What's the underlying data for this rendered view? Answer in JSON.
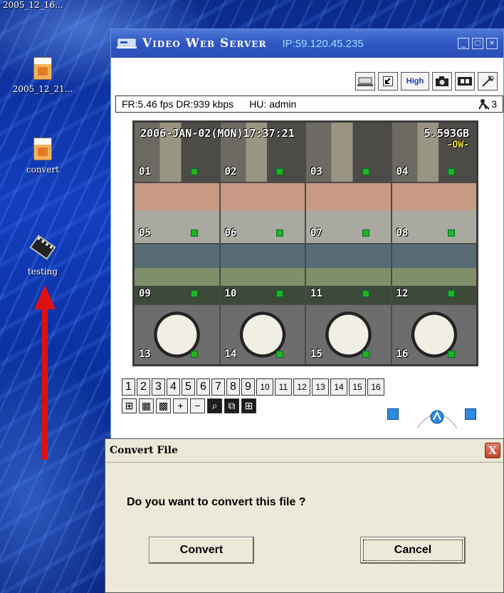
{
  "desktop": {
    "top_label": "2005_12_16...",
    "icons": [
      {
        "label": "2005_12_21...",
        "icon": "file-icon"
      },
      {
        "label": "convert",
        "icon": "file-icon"
      },
      {
        "label": "testing",
        "icon": "video-file-icon"
      }
    ],
    "arrow_color": "#e01010"
  },
  "video_server": {
    "title": "Video Web Server",
    "ip": "IP:59.120.45.235",
    "window_controls": [
      "_",
      "□",
      "×"
    ],
    "toolbar": {
      "high_label": "High"
    },
    "status": {
      "frame_rate": "FR:5.46 fps DR:939 kbps",
      "user": "HU: admin",
      "user_count": "3"
    },
    "osd": {
      "datetime": "2006-JAN-02(MON)17:37:21",
      "disk": "5.593GB",
      "overwrite": "-OW-"
    },
    "cameras": [
      "01",
      "02",
      "03",
      "04",
      "05",
      "06",
      "07",
      "08",
      "09",
      "10",
      "11",
      "12",
      "13",
      "14",
      "15",
      "16"
    ],
    "channel_buttons": [
      "1",
      "2",
      "3",
      "4",
      "5",
      "6",
      "7",
      "8",
      "9",
      "10",
      "11",
      "12",
      "13",
      "14",
      "15",
      "16"
    ],
    "view_buttons": [
      "⊞",
      "▦",
      "▩",
      "+",
      "−",
      "⌕",
      "⧉",
      "⊞"
    ],
    "accent_color": "#2f57c2"
  },
  "dialog": {
    "title": "Convert File",
    "message": "Do you want to convert this file ?",
    "convert_label": "Convert",
    "cancel_label": "Cancel",
    "close_label": "X"
  }
}
